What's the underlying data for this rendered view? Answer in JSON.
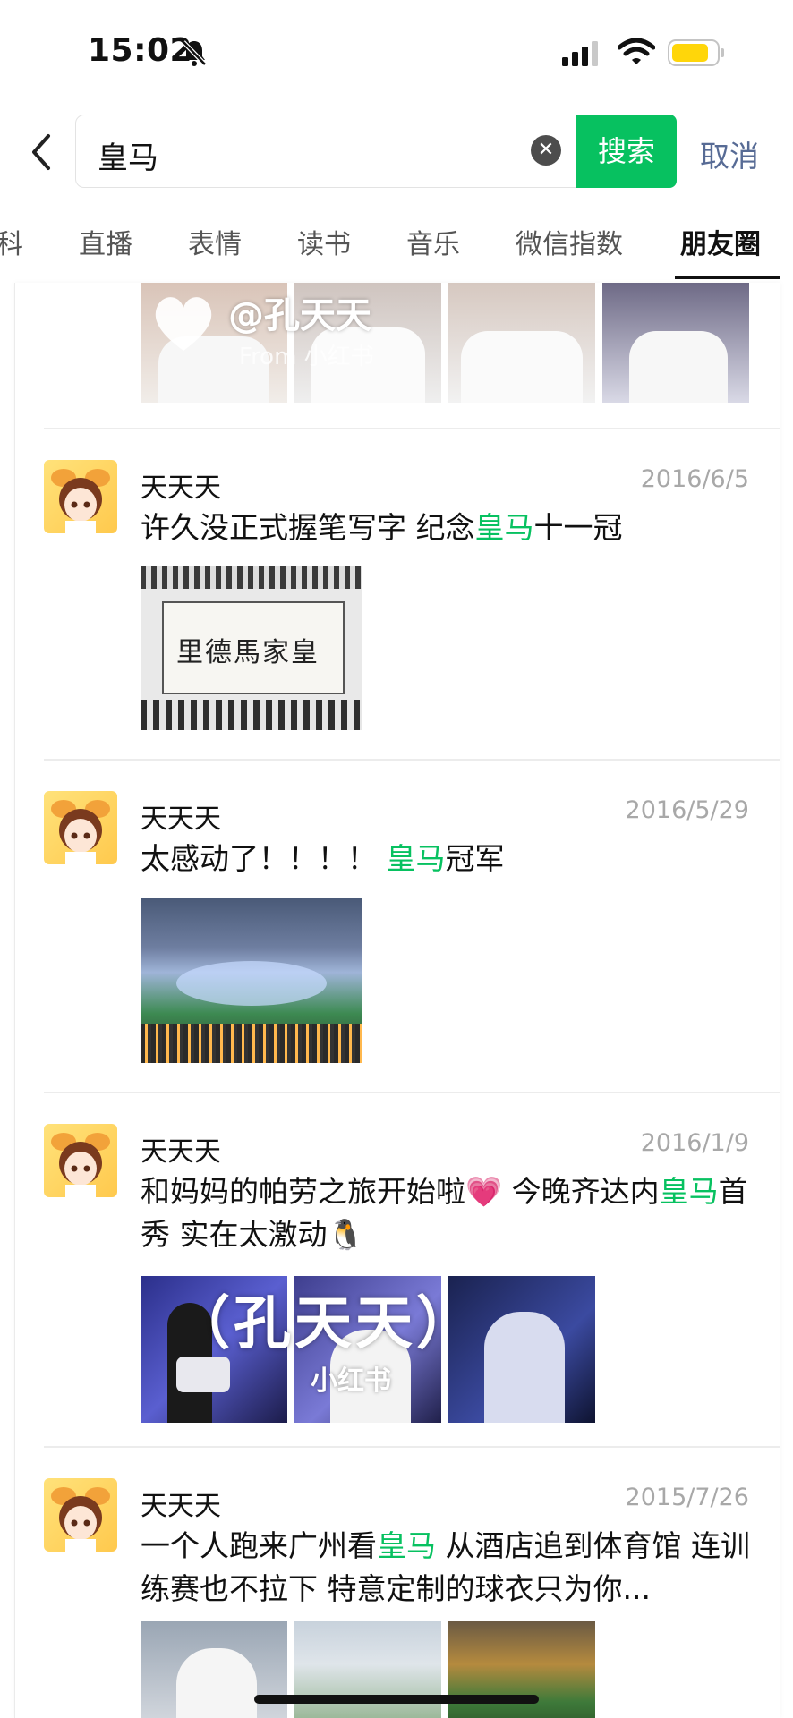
{
  "status": {
    "time": "15:02"
  },
  "search": {
    "query": "皇马",
    "button": "搜索",
    "cancel": "取消"
  },
  "tabs": [
    "科",
    "直播",
    "表情",
    "读书",
    "音乐",
    "微信指数",
    "朋友圈"
  ],
  "active_tab": "朋友圈",
  "watermarks": {
    "w1_handle": "@孔天天",
    "w1_from": "From 小红书",
    "w2_handle": "（孔天天）",
    "w2_from": "小红书"
  },
  "posts": [
    {
      "name": "天天天",
      "date": "2016/6/5",
      "text_parts": [
        "许久没正式握笔写字 纪念",
        "皇马",
        "十一冠"
      ],
      "calligraphy": "皇家馬德里"
    },
    {
      "name": "天天天",
      "date": "2016/5/29",
      "text_parts": [
        "太感动了！！！！ ",
        "皇马",
        "冠军"
      ]
    },
    {
      "name": "天天天",
      "date": "2016/1/9",
      "text_parts": [
        "和妈妈的帕劳之旅开始啦💗 今晚齐达内",
        "皇马",
        "首秀 实在太激动🐧"
      ]
    },
    {
      "name": "天天天",
      "date": "2015/7/26",
      "text_parts": [
        "一个人跑来广州看",
        "皇马",
        " 从酒店追到体育馆 连训练赛也不拉下 特意定制的球衣只为你..."
      ]
    }
  ],
  "colors": {
    "accent": "#07c160",
    "link": "#576b95",
    "date": "#a8a8a8"
  }
}
